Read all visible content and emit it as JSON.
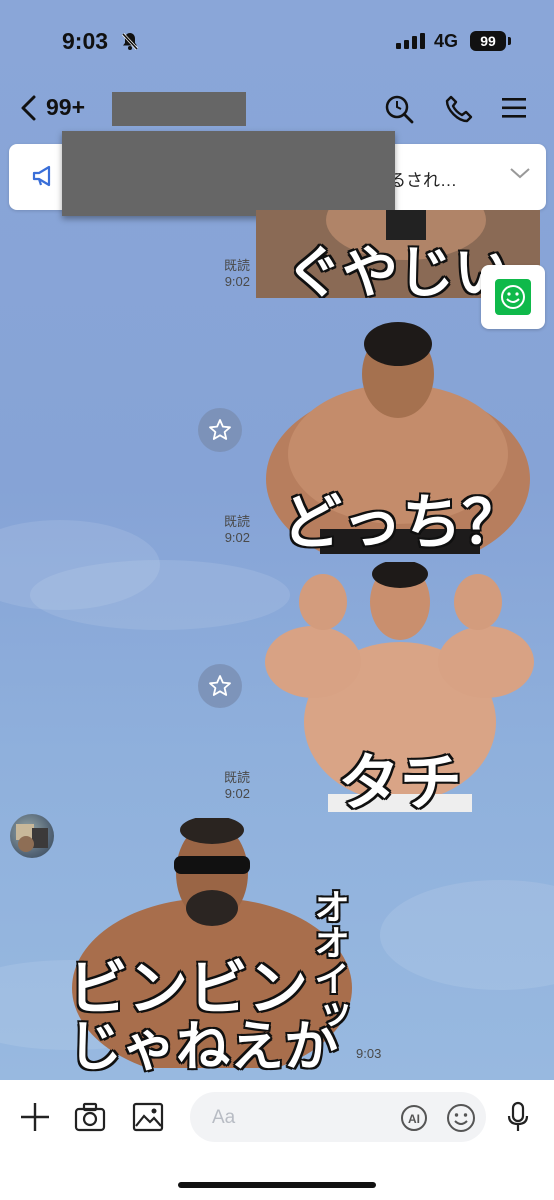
{
  "status": {
    "time": "9:03",
    "network": "4G",
    "battery": "99"
  },
  "header": {
    "unread_count": "99+"
  },
  "announcement": {
    "text": "るされ…"
  },
  "messages": [
    {
      "read": "既読",
      "time": "9:02",
      "caption": "ぐやじい"
    },
    {
      "read": "既読",
      "time": "9:02",
      "caption": "どっち？"
    },
    {
      "read": "既読",
      "time": "9:02",
      "caption": "タチ"
    },
    {
      "time": "9:03",
      "caption_line1": "ビンビン",
      "caption_line2": "じゃねえか",
      "caption_side": "オオイッ"
    }
  ],
  "input": {
    "placeholder": "Aa",
    "ai_label": "AI"
  },
  "colors": {
    "chat_bg": "#8aa6d8",
    "line_green": "#0fb94a"
  }
}
